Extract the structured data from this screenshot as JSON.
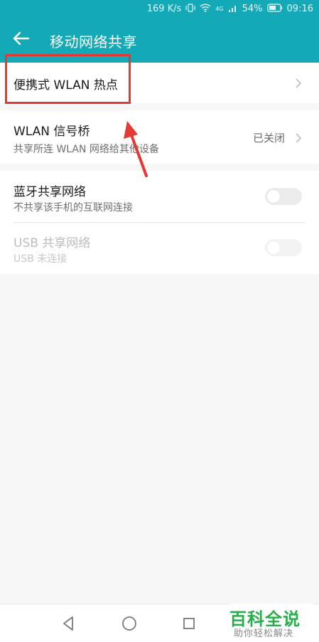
{
  "status": {
    "speed": "169 K/s",
    "battery": "54%",
    "time": "09:16",
    "network_tag": "4G"
  },
  "header": {
    "title": "移动网络共享"
  },
  "items": {
    "hotspot": {
      "label": "便携式 WLAN 热点"
    },
    "bridge": {
      "label": "WLAN 信号桥",
      "sub": "共享所连 WLAN 网络给其他设备",
      "value": "已关闭"
    },
    "bluetooth": {
      "label": "蓝牙共享网络",
      "sub": "不共享该手机的互联网连接"
    },
    "usb": {
      "label": "USB 共享网络",
      "sub": "USB 未连接"
    }
  },
  "watermark": {
    "title": "百科全说",
    "subtitle": "助你轻松解决"
  },
  "colors": {
    "accent": "#14a9b7",
    "annotation": "#e53935",
    "watermark": "#27ad4a"
  }
}
